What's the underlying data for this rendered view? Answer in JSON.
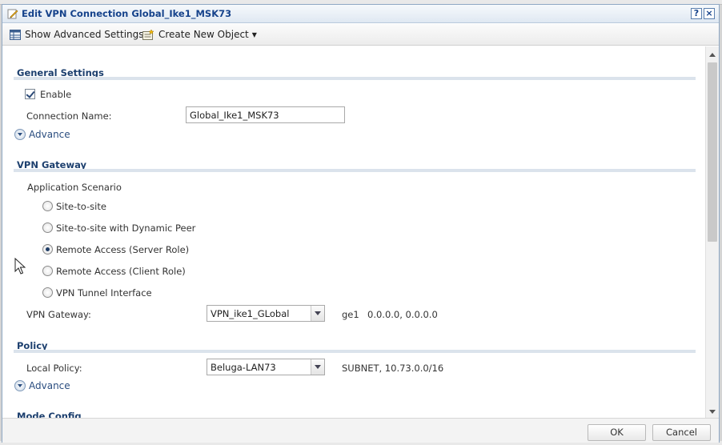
{
  "window": {
    "title": "Edit VPN Connection Global_Ike1_MSK73",
    "help_label": "?",
    "close_label": "×"
  },
  "toolbar": {
    "show_advanced": "Show Advanced Settings",
    "create_new": "Create New Object"
  },
  "general": {
    "title": "General Settings",
    "enable_label": "Enable",
    "enable_checked": true,
    "connection_name_label": "Connection Name:",
    "connection_name_value": "Global_Ike1_MSK73",
    "advance_label": "Advance"
  },
  "vpn_gateway": {
    "title": "VPN Gateway",
    "scenario_label": "Application Scenario",
    "scenarios": [
      {
        "label": "Site-to-site",
        "selected": false
      },
      {
        "label": "Site-to-site with Dynamic Peer",
        "selected": false
      },
      {
        "label": "Remote Access (Server Role)",
        "selected": true
      },
      {
        "label": "Remote Access (Client Role)",
        "selected": false
      },
      {
        "label": "VPN Tunnel Interface",
        "selected": false
      }
    ],
    "gateway_label": "VPN Gateway:",
    "gateway_value": "VPN_ike1_GLobal",
    "gateway_info_iface": "ge1",
    "gateway_info_addr": "0.0.0.0, 0.0.0.0"
  },
  "policy": {
    "title": "Policy",
    "local_policy_label": "Local Policy:",
    "local_policy_value": "Beluga-LAN73",
    "local_policy_info": "SUBNET, 10.73.0.0/16",
    "advance_label": "Advance"
  },
  "mode_config": {
    "title": "Mode Config"
  },
  "footer": {
    "ok_label": "OK",
    "cancel_label": "Cancel"
  }
}
